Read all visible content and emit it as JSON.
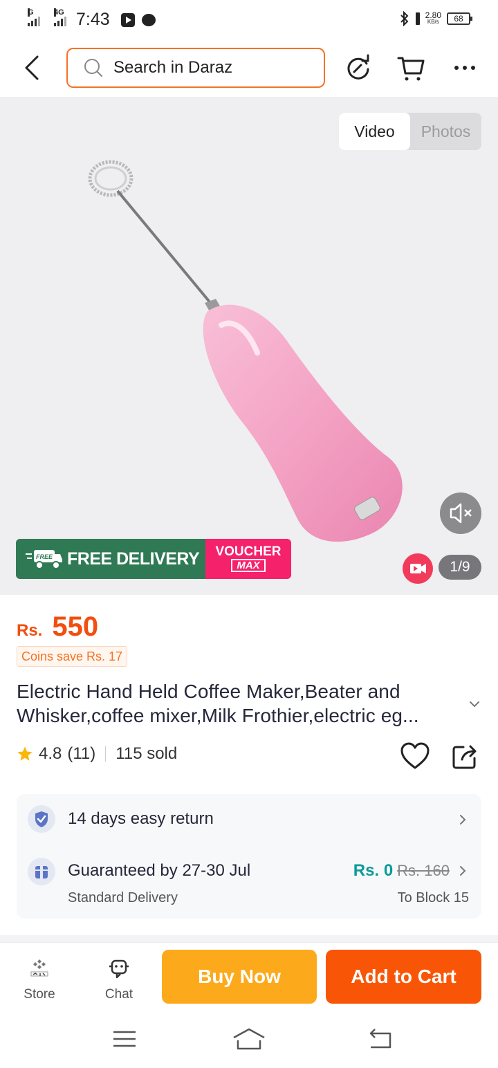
{
  "status_bar": {
    "network_1": "G",
    "network_2": "4G",
    "time": "7:43",
    "speed_value": "2.80",
    "speed_unit": "KB/s",
    "battery": "68"
  },
  "header": {
    "search_placeholder": "Search in Daraz",
    "icons": [
      "back-arrow-icon",
      "refresh-icon",
      "cart-icon",
      "more-icon"
    ]
  },
  "media": {
    "tabs": [
      {
        "label": "Video",
        "active": true
      },
      {
        "label": "Photos",
        "active": false
      }
    ],
    "promo_free_delivery": "FREE DELIVERY",
    "promo_truck_text": "FREE",
    "promo_voucher": "VOUCHER",
    "promo_voucher_max": "MAX",
    "counter": "1/9",
    "colors": {
      "free_delivery_bg": "#2f7a55",
      "voucher_bg": "#f5216b",
      "product": "#f4a7c7"
    }
  },
  "product": {
    "currency": "Rs.",
    "price": "550",
    "coins_text": "Coins save Rs. 17",
    "title": "Electric Hand Held Coffee Maker,Beater and Whisker,coffee mixer,Milk Frothier,electric eg...",
    "rating": "4.8",
    "rating_count": "(11)",
    "sold": "115 sold"
  },
  "services": {
    "return_text": "14 days easy return",
    "delivery_guarantee": "Guaranteed by 27-30 Jul",
    "delivery_type": "Standard Delivery",
    "delivery_price_now": "Rs. 0",
    "delivery_price_old": "Rs. 160",
    "delivery_to": "To Block 15"
  },
  "bottom_bar": {
    "store_label": "Store",
    "chat_label": "Chat",
    "buy_now": "Buy Now",
    "add_to_cart": "Add to Cart",
    "colors": {
      "buy_now": "#fcaa1c",
      "add_to_cart": "#f85606"
    }
  }
}
